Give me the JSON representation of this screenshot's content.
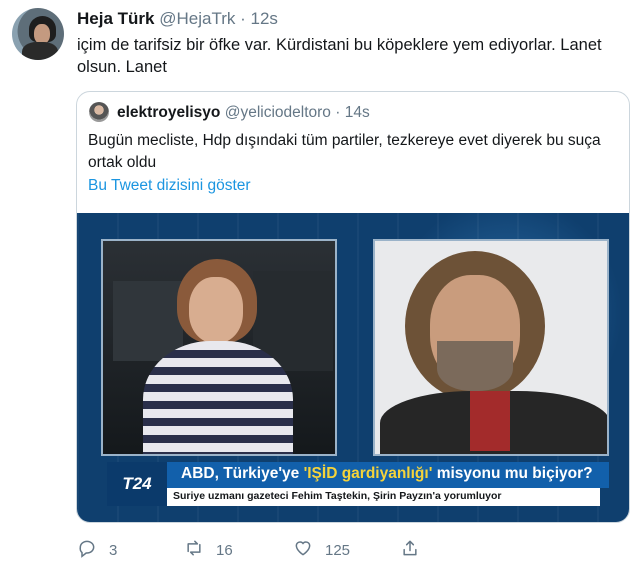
{
  "tweet": {
    "display_name": "Heja Türk",
    "handle": "@HejaTrk",
    "separator": "·",
    "time": "12s",
    "text": "içim de tarifsiz bir öfke var. Kürdistani bu köpeklere yem ediyorlar. Lanet olsun. Lanet"
  },
  "quoted_tweet": {
    "display_name": "elektroyelisyo",
    "handle": "@yeliciodeltoro",
    "separator": "·",
    "time": "14s",
    "text": "Bugün mecliste, Hdp dışındaki tüm partiler, tezkereye evet diyerek bu suça ortak oldu",
    "thread_link": "Bu Tweet dizisini göster"
  },
  "video": {
    "channel": "T24",
    "headline_prefix": "ABD, Türkiye'ye ",
    "headline_highlight": "'IŞİD gardiyanlığı'",
    "headline_suffix": " misyonu mu biçiyor?",
    "subtitle": "Suriye uzmanı gazeteci Fehim Taştekin, Şirin Payzın'a yorumluyor"
  },
  "actions": {
    "replies": "3",
    "retweets": "16",
    "likes": "125"
  },
  "icons": {
    "reply": "reply-icon",
    "retweet": "retweet-icon",
    "like": "heart-icon",
    "share": "share-icon"
  },
  "colors": {
    "text": "#14171a",
    "secondary": "#657786",
    "link": "#1b95e0",
    "border": "#ccd6dd",
    "video_blue": "#1260ab",
    "highlight": "#f5d33a"
  }
}
